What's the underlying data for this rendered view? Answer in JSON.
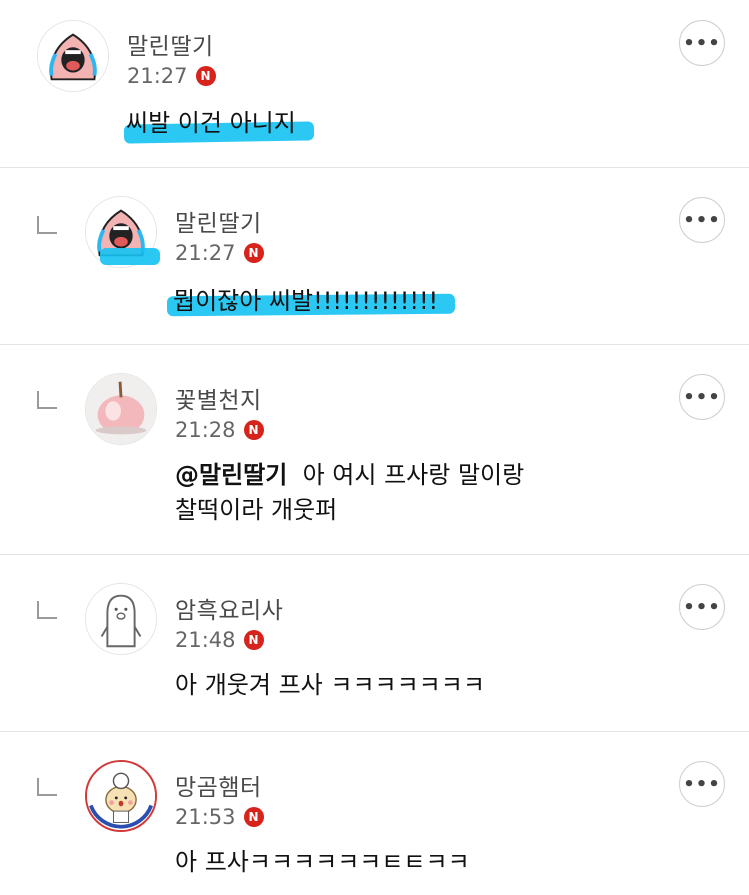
{
  "comments": [
    {
      "name": "말린딸기",
      "time": "21:27",
      "badge": "N",
      "text": "씨발 이건 아니지",
      "more": "•••",
      "avatar": "crying-face-icon",
      "is_reply": false
    },
    {
      "name": "말린딸기",
      "time": "21:27",
      "badge": "N",
      "text": "뭡이잖아 씨발!!!!!!!!!!!!!",
      "more": "•••",
      "avatar": "crying-face-icon",
      "is_reply": true
    },
    {
      "name": "꽃별천지",
      "time": "21:28",
      "badge": "N",
      "mention": "@말린딸기",
      "text_line1": "아 여시 프사랑 말이랑",
      "text_line2": "찰떡이라 개웃퍼",
      "more": "•••",
      "avatar": "pink-apple-icon",
      "is_reply": true
    },
    {
      "name": "암흑요리사",
      "time": "21:48",
      "badge": "N",
      "text": "아 개웃겨 프사 ㅋㅋㅋㅋㅋㅋㅋ",
      "more": "•••",
      "avatar": "ghost-character-icon",
      "is_reply": true
    },
    {
      "name": "망곰햄터",
      "time": "21:53",
      "badge": "N",
      "text": "아 프사ㅋㅋㅋㅋㅋㅋㅌㅌㅋㅋ",
      "more": "•••",
      "avatar": "hamster-chef-icon",
      "is_reply": true
    }
  ],
  "colors": {
    "highlight": "#14c2f2",
    "badge": "#d6231c",
    "divider": "#e3e3e3"
  }
}
